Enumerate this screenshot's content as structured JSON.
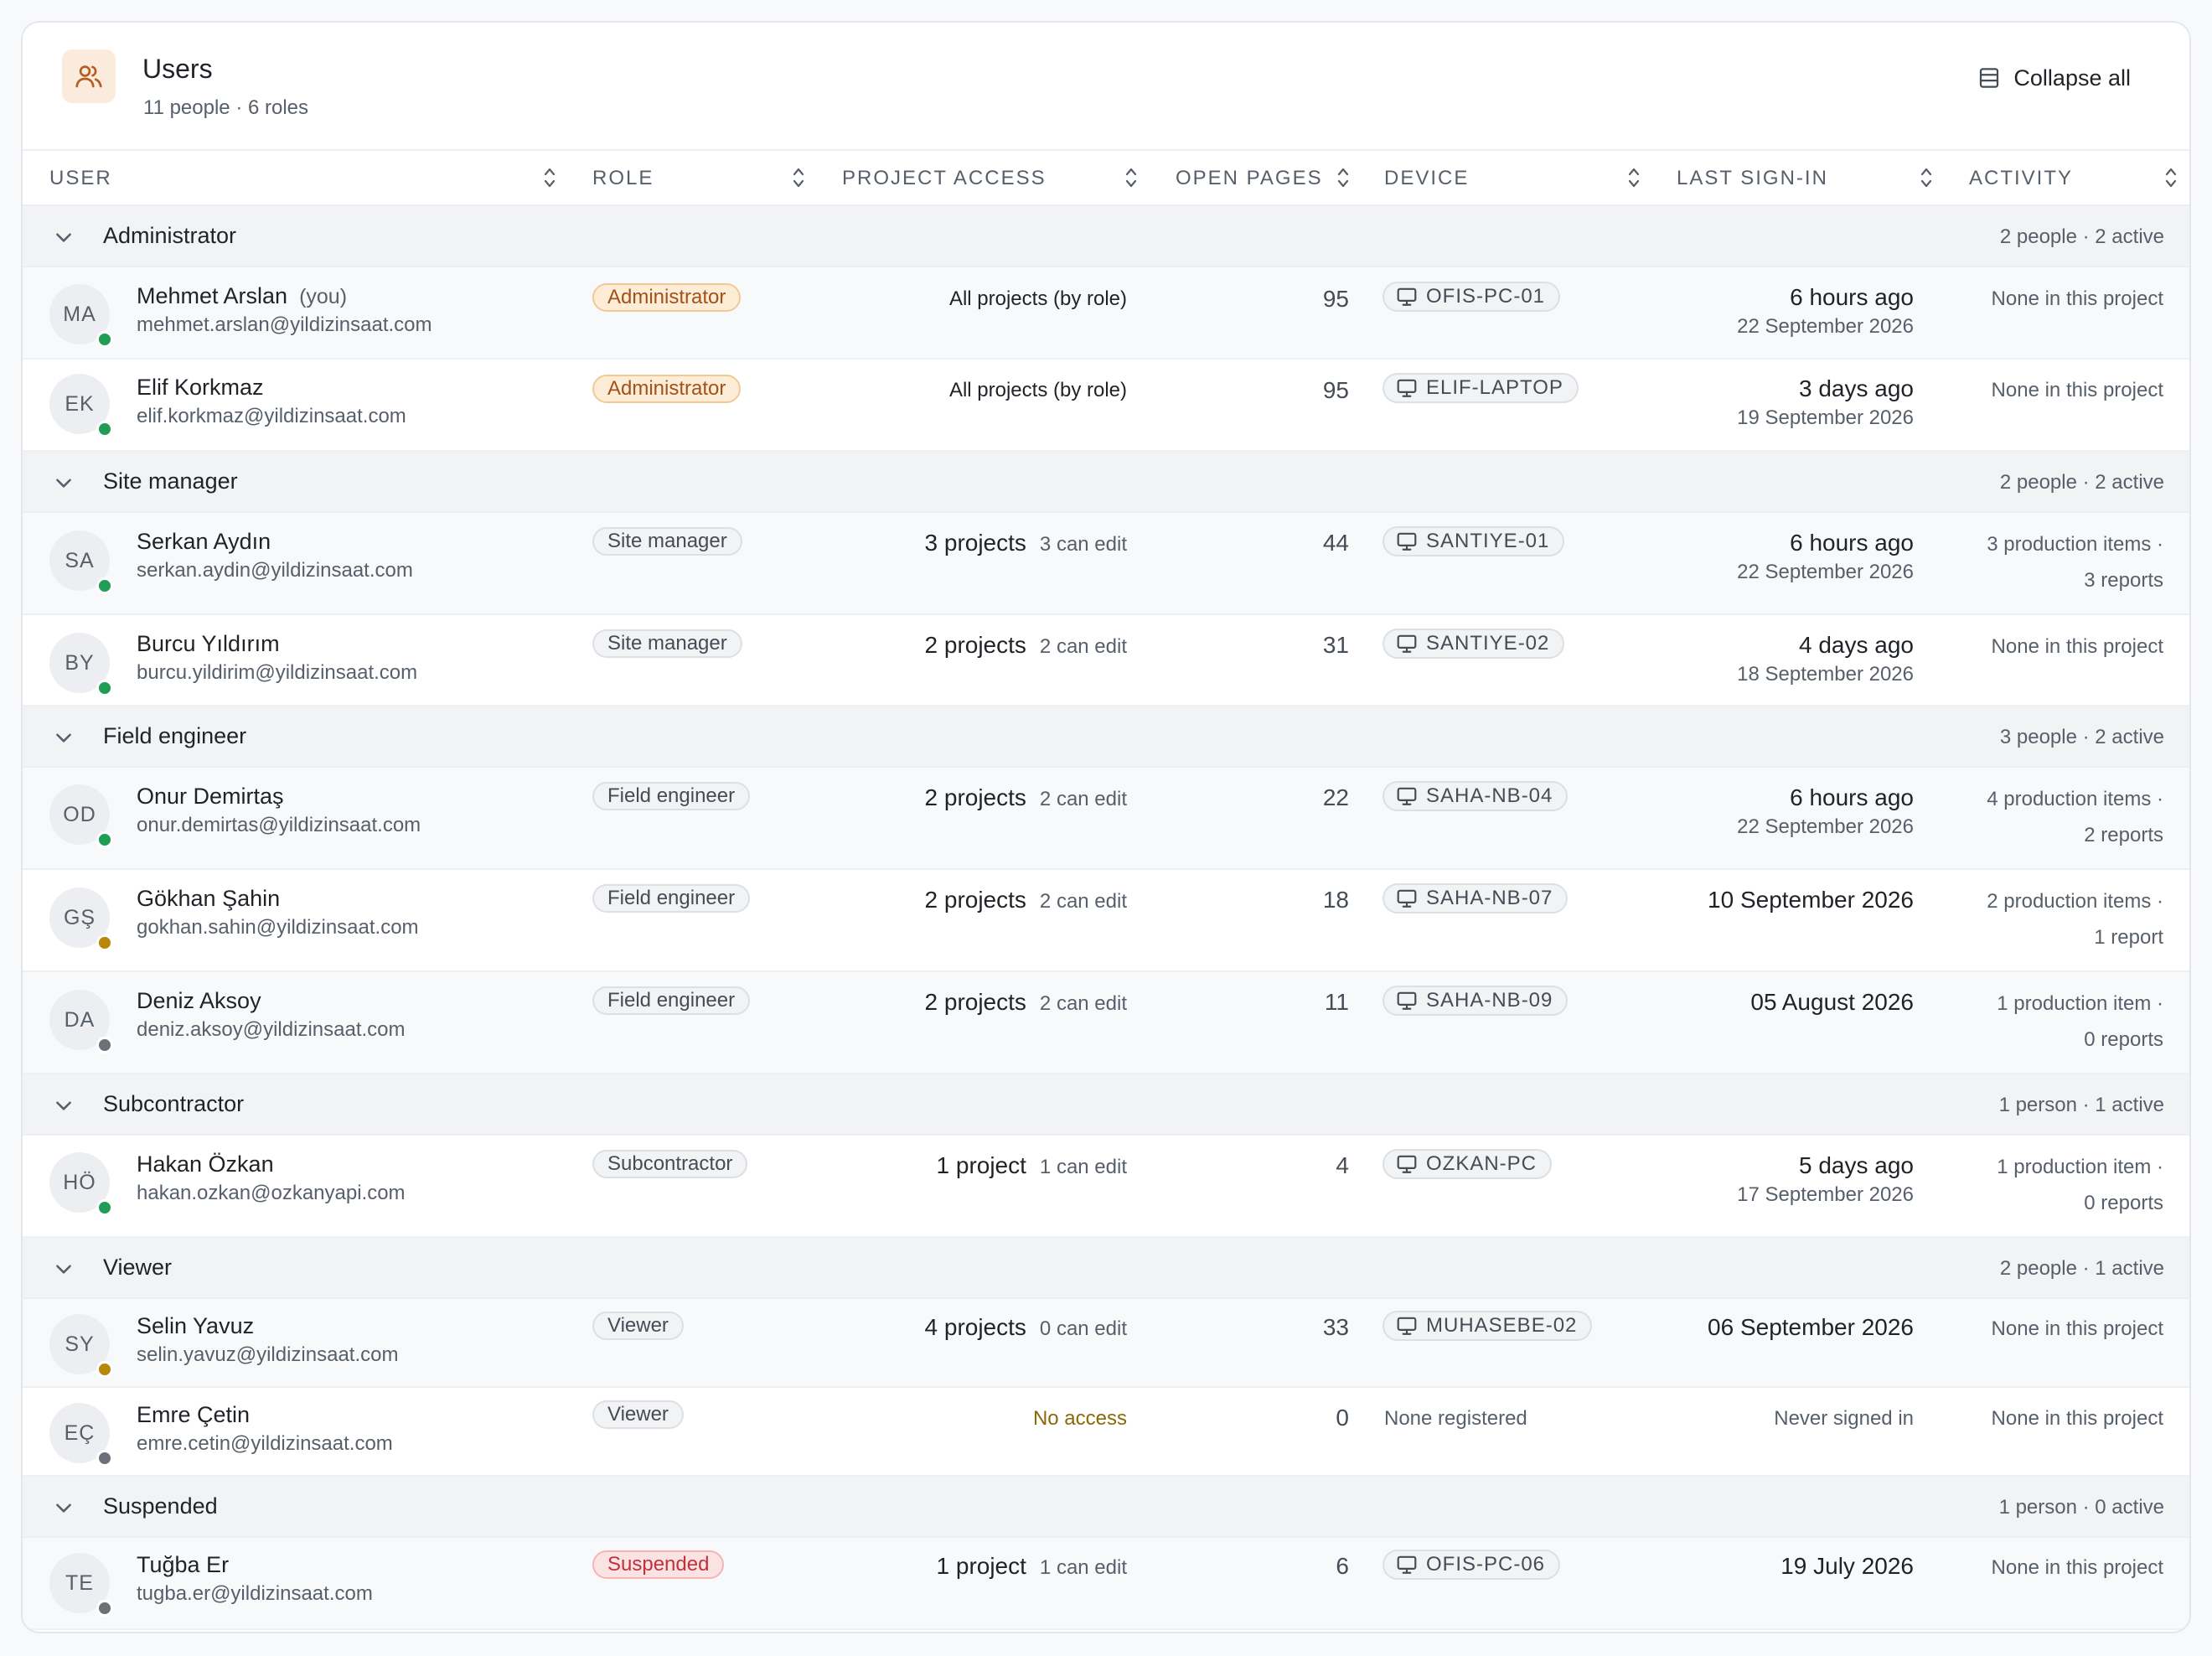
{
  "header": {
    "title": "Users",
    "subtitle": "11 people · 6 roles",
    "icon": "users-icon",
    "collapse_label": "Collapse all"
  },
  "columns": {
    "user": "USER",
    "role": "ROLE",
    "project_access": "PROJECT ACCESS",
    "open_pages": "OPEN PAGES",
    "device": "DEVICE",
    "last_sign_in": "LAST SIGN-IN",
    "activity": "ACTIVITY"
  },
  "groups": {
    "administrator": {
      "name": "Administrator",
      "count": "2 people · 2 active"
    },
    "site_manager": {
      "name": "Site manager",
      "count": "2 people · 2 active"
    },
    "field_engineer": {
      "name": "Field engineer",
      "count": "3 people · 2 active"
    },
    "subcontractor": {
      "name": "Subcontractor",
      "count": "1 person · 1 active"
    },
    "viewer": {
      "name": "Viewer",
      "count": "2 people · 1 active"
    },
    "suspended": {
      "name": "Suspended",
      "count": "1 person · 0 active"
    }
  },
  "status_colors": {
    "active": "#1f9d55",
    "idle": "#b8860b",
    "offline": "#6b7079"
  },
  "users": {
    "mehmet": {
      "initials": "MA",
      "name": "Mehmet Arslan",
      "you": "(you)",
      "email": "mehmet.arslan@yildizinsaat.com",
      "role": "Administrator",
      "access": "All projects (by role)",
      "pages": "95",
      "device": "OFIS-PC-01",
      "signin": "6 hours ago",
      "signin_date": "22 September 2026",
      "activity": "None in this project",
      "status": "active"
    },
    "elif": {
      "initials": "EK",
      "name": "Elif Korkmaz",
      "email": "elif.korkmaz@yildizinsaat.com",
      "role": "Administrator",
      "access": "All projects (by role)",
      "pages": "95",
      "device": "ELIF-LAPTOP",
      "signin": "3 days ago",
      "signin_date": "19 September 2026",
      "activity": "None in this project",
      "status": "active"
    },
    "serkan": {
      "initials": "SA",
      "name": "Serkan Aydın",
      "email": "serkan.aydin@yildizinsaat.com",
      "role": "Site manager",
      "access": "3 projects",
      "edit": "3 can edit",
      "pages": "44",
      "device": "SANTIYE-01",
      "signin": "6 hours ago",
      "signin_date": "22 September 2026",
      "activity": "3 production items ·",
      "activity2": "3 reports",
      "status": "active"
    },
    "burcu": {
      "initials": "BY",
      "name": "Burcu Yıldırım",
      "email": "burcu.yildirim@yildizinsaat.com",
      "role": "Site manager",
      "access": "2 projects",
      "edit": "2 can edit",
      "pages": "31",
      "device": "SANTIYE-02",
      "signin": "4 days ago",
      "signin_date": "18 September 2026",
      "activity": "None in this project",
      "status": "active"
    },
    "onur": {
      "initials": "OD",
      "name": "Onur Demirtaş",
      "email": "onur.demirtas@yildizinsaat.com",
      "role": "Field engineer",
      "access": "2 projects",
      "edit": "2 can edit",
      "pages": "22",
      "device": "SAHA-NB-04",
      "signin": "6 hours ago",
      "signin_date": "22 September 2026",
      "activity": "4 production items ·",
      "activity2": "2 reports",
      "status": "active"
    },
    "gokhan": {
      "initials": "GŞ",
      "name": "Gökhan Şahin",
      "email": "gokhan.sahin@yildizinsaat.com",
      "role": "Field engineer",
      "access": "2 projects",
      "edit": "2 can edit",
      "pages": "18",
      "device": "SAHA-NB-07",
      "signin": "10 September 2026",
      "activity": "2 production items ·",
      "activity2": "1 report",
      "status": "idle"
    },
    "deniz": {
      "initials": "DA",
      "name": "Deniz Aksoy",
      "email": "deniz.aksoy@yildizinsaat.com",
      "role": "Field engineer",
      "access": "2 projects",
      "edit": "2 can edit",
      "pages": "11",
      "device": "SAHA-NB-09",
      "signin": "05 August 2026",
      "activity": "1 production item ·",
      "activity2": "0 reports",
      "status": "offline"
    },
    "hakan": {
      "initials": "HÖ",
      "name": "Hakan Özkan",
      "email": "hakan.ozkan@ozkanyapi.com",
      "role": "Subcontractor",
      "access": "1 project",
      "edit": "1 can edit",
      "pages": "4",
      "device": "OZKAN-PC",
      "signin": "5 days ago",
      "signin_date": "17 September 2026",
      "activity": "1 production item ·",
      "activity2": "0 reports",
      "status": "active"
    },
    "selin": {
      "initials": "SY",
      "name": "Selin Yavuz",
      "email": "selin.yavuz@yildizinsaat.com",
      "role": "Viewer",
      "access": "4 projects",
      "edit": "0 can edit",
      "pages": "33",
      "device": "MUHASEBE-02",
      "signin": "06 September 2026",
      "activity": "None in this project",
      "status": "idle"
    },
    "emre": {
      "initials": "EÇ",
      "name": "Emre Çetin",
      "email": "emre.cetin@yildizinsaat.com",
      "role": "Viewer",
      "access": "No access",
      "pages": "0",
      "device": "None registered",
      "signin": "Never signed in",
      "activity": "None in this project",
      "status": "offline"
    },
    "tugba": {
      "initials": "TE",
      "name": "Tuğba Er",
      "email": "tugba.er@yildizinsaat.com",
      "role": "Suspended",
      "access": "1 project",
      "edit": "1 can edit",
      "pages": "6",
      "device": "OFIS-PC-06",
      "signin": "19 July 2026",
      "activity": "None in this project",
      "status": "offline"
    }
  }
}
